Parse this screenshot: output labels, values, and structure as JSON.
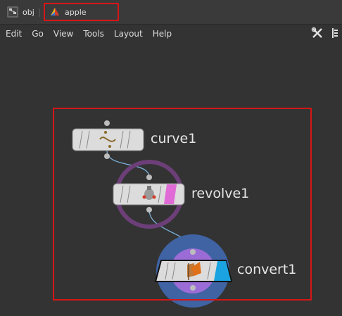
{
  "pathbar": {
    "root_label": "obj",
    "current_label": "apple"
  },
  "menu": {
    "items": [
      "Edit",
      "Go",
      "View",
      "Tools",
      "Layout",
      "Help"
    ]
  },
  "nodes": [
    {
      "name": "curve1",
      "icon": "curve-icon"
    },
    {
      "name": "revolve1",
      "icon": "revolve-icon"
    },
    {
      "name": "convert1",
      "icon": "convert-icon"
    }
  ],
  "colors": {
    "selection_box": "#d51616",
    "revolve_ring": "#6d3f78",
    "convert_outer": "#3f63a3",
    "convert_inner": "#9b6cd6",
    "revolve_flag": "#e06bd6",
    "convert_flag": "#1aa3e0"
  }
}
